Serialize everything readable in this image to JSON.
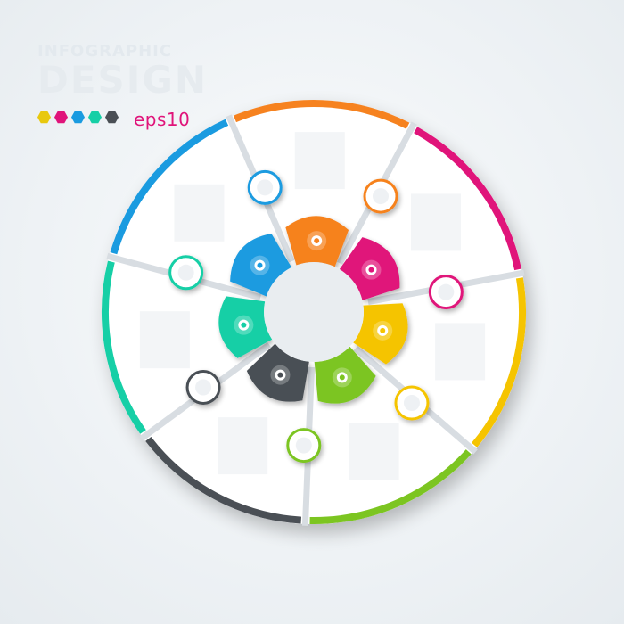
{
  "title": {
    "small": "INFOGRAPHIC",
    "large": "DESIGN"
  },
  "badge": "eps10",
  "colors": {
    "pink": "#e0147a",
    "yellow": "#f5c400",
    "green": "#7cc521",
    "dark": "#4a4f55",
    "teal": "#16cfa6",
    "blue": "#1a9be0",
    "orange": "#f6821f",
    "swatches": [
      "#e8c80e",
      "#e0147a",
      "#1a9be0",
      "#16cfa6",
      "#4a4f55"
    ]
  },
  "segments": [
    {
      "name": "pink",
      "color": "#e0147a",
      "icon": "globe-icon"
    },
    {
      "name": "yellow",
      "color": "#f5c400",
      "icon": "lightbulb-icon"
    },
    {
      "name": "green",
      "color": "#7cc521",
      "icon": "gears-icon"
    },
    {
      "name": "dark",
      "color": "#4a4f55",
      "icon": "bulb-idea-icon"
    },
    {
      "name": "teal",
      "color": "#16cfa6",
      "icon": "target-icon"
    },
    {
      "name": "blue",
      "color": "#1a9be0",
      "icon": "handshake-icon"
    },
    {
      "name": "orange",
      "color": "#f6821f",
      "icon": "team-icon"
    }
  ]
}
